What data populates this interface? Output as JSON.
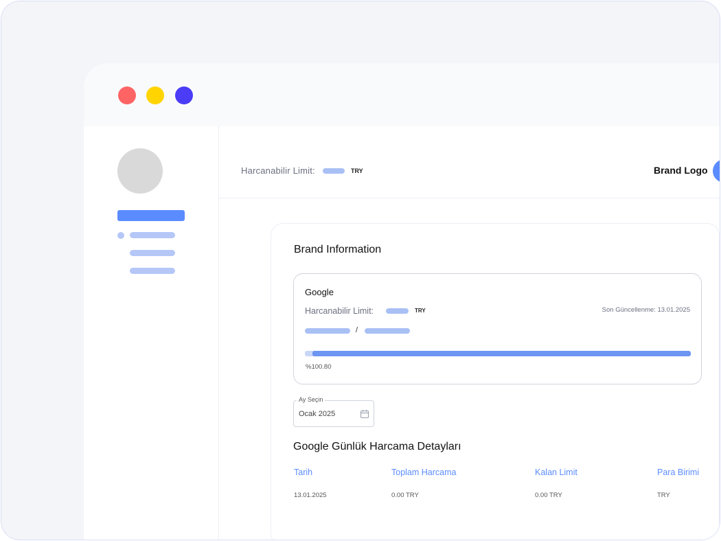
{
  "header": {
    "limit_label": "Harcanabilir Limit:",
    "limit_currency": "TRY",
    "brand_logo": "Brand Logo"
  },
  "card": {
    "title": "Brand Information",
    "brand": {
      "name": "Google",
      "limit_label": "Harcanabilir Limit:",
      "limit_currency": "TRY",
      "last_updated": "Son Güncellenme: 13.01.2025",
      "separator": "/",
      "usage_percent_text": "%100.80",
      "usage_fraction": 1.0
    },
    "month_select": {
      "label": "Ay Seçin",
      "value": "Ocak 2025",
      "icon": "calendar-icon"
    },
    "details": {
      "title": "Google Günlük Harcama Detayları",
      "columns": [
        "Tarih",
        "Toplam Harcama",
        "Kalan Limit",
        "Para Birimi"
      ],
      "rows": [
        [
          "13.01.2025",
          "0.00 TRY",
          "0.00 TRY",
          "TRY"
        ]
      ]
    }
  },
  "colors": {
    "accent": "#5b8cff",
    "placeholder": "#b4c7f7",
    "window_red": "#ff6464",
    "window_yellow": "#ffd400",
    "window_blue": "#4a3cf7"
  }
}
